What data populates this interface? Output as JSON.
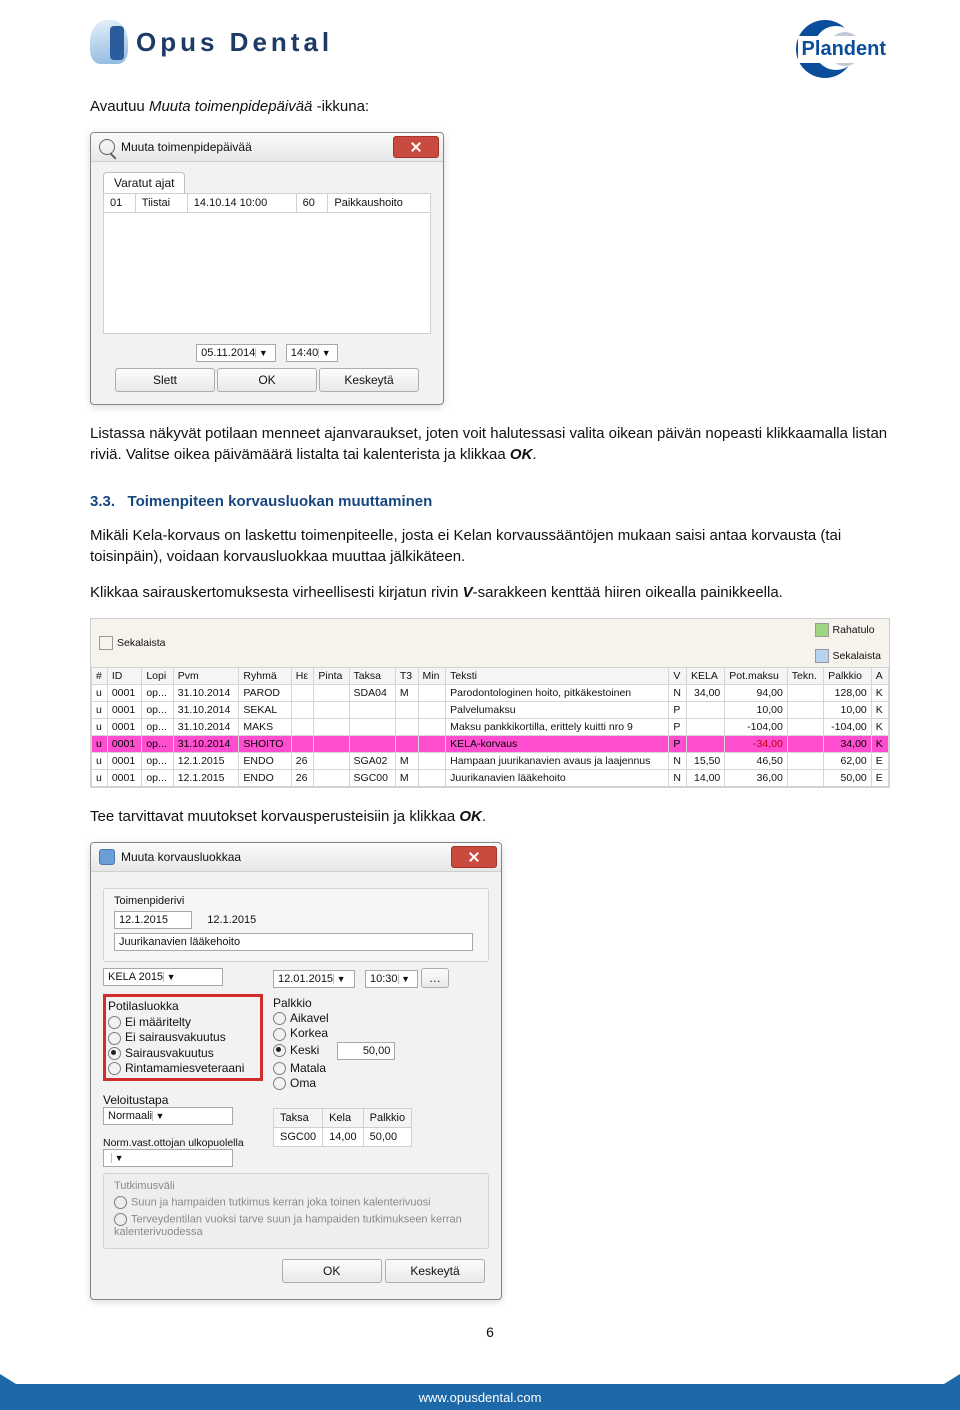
{
  "header": {
    "logo_text": "Opus Dental",
    "plandent": "Plandent"
  },
  "intro": {
    "line1_prefix": "Avautuu ",
    "line1_em": "Muuta toimenpidepäivää",
    "line1_suffix": " -ikkuna:"
  },
  "dialog1": {
    "title": "Muuta toimenpidepäivää",
    "tab": "Varatut ajat",
    "row": {
      "n": "01",
      "day": "Tiistai",
      "date": "14.10.14 10:00",
      "dur": "60",
      "proc": "Paikkaushoito"
    },
    "date_field": "05.11.2014",
    "time_field": "14:40",
    "btn_slett": "Slett",
    "btn_ok": "OK",
    "btn_cancel": "Keskeytä"
  },
  "para1": {
    "a": "Listassa näkyvät potilaan menneet ajanvaraukset, joten voit halutessasi valita oikean päivän nopeasti klikkaamalla listan riviä. Valitse oikea päivämäärä listalta tai kalenterista ja klikkaa ",
    "ok": "OK",
    "b": "."
  },
  "section": {
    "num": "3.3.",
    "title": "Toimenpiteen korvausluokan muuttaminen"
  },
  "para2": "Mikäli Kela-korvaus on laskettu toimenpiteelle, josta ei Kelan korvaussääntöjen mukaan saisi antaa korvausta (tai toisinpäin), voidaan korvausluokkaa muuttaa jälkikäteen.",
  "para3": {
    "a": "Klikkaa sairauskertomuksesta virheellisesti kirjatun rivin ",
    "v": "V",
    "b": "-sarakkeen kenttää hiiren oikealla painikkeella."
  },
  "sk": {
    "tab_left": "Sekalaista",
    "tab_r1": "Rahatulo",
    "tab_r2": "Sekalaista",
    "cols": [
      "#",
      "ID",
      "Lopi",
      "Pvm",
      "Ryhmä",
      "Hε",
      "Pinta",
      "Taksa",
      "T3",
      "Min",
      "Teksti",
      "V",
      "KELA",
      "Pot.maksu",
      "Tekn.",
      "Palkkio",
      "A"
    ],
    "rows": [
      {
        "h": "u",
        "id": "0001",
        "lop": "op...",
        "pvm": "31.10.2014",
        "ryhma": "PAROD",
        "he": "",
        "pinta": "",
        "taksa": "SDA04",
        "t3": "M",
        "min": "",
        "teksti": "Parodontologinen hoito, pitkäkestoinen",
        "v": "N",
        "kela": "34,00",
        "pot": "94,00",
        "tekn": "",
        "palkkio": "128,00",
        "a": "K"
      },
      {
        "h": "u",
        "id": "0001",
        "lop": "op...",
        "pvm": "31.10.2014",
        "ryhma": "SEKAL",
        "he": "",
        "pinta": "",
        "taksa": "",
        "t3": "",
        "min": "",
        "teksti": "Palvelumaksu",
        "v": "P",
        "kela": "",
        "pot": "10,00",
        "tekn": "",
        "palkkio": "10,00",
        "a": "K"
      },
      {
        "h": "u",
        "id": "0001",
        "lop": "op...",
        "pvm": "31.10.2014",
        "ryhma": "MAKS",
        "he": "",
        "pinta": "",
        "taksa": "",
        "t3": "",
        "min": "",
        "teksti": "Maksu pankkikortilla, erittely kuitti nro 9",
        "v": "P",
        "kela": "",
        "pot": "-104,00",
        "tekn": "",
        "palkkio": "-104,00",
        "a": "K"
      },
      {
        "h": "u",
        "id": "0001",
        "lop": "op...",
        "pvm": "31.10.2014",
        "ryhma": "SHOITO",
        "he": "",
        "pinta": "",
        "taksa": "",
        "t3": "",
        "min": "",
        "teksti": "KELA-korvaus",
        "v": "P",
        "kela": "",
        "pot": "-34,00",
        "tekn": "",
        "palkkio": "34,00",
        "a": "K",
        "pink": true
      },
      {
        "h": "u",
        "id": "0001",
        "lop": "op...",
        "pvm": "12.1.2015",
        "ryhma": "ENDO",
        "he": "26",
        "pinta": "",
        "taksa": "SGA02",
        "t3": "M",
        "min": "",
        "teksti": "Hampaan juurikanavien avaus ja laajennus",
        "v": "N",
        "kela": "15,50",
        "pot": "46,50",
        "tekn": "",
        "palkkio": "62,00",
        "a": "E",
        "hl": true
      },
      {
        "h": "u",
        "id": "0001",
        "lop": "op...",
        "pvm": "12.1.2015",
        "ryhma": "ENDO",
        "he": "26",
        "pinta": "",
        "taksa": "SGC00",
        "t3": "M",
        "min": "",
        "teksti": "Juurikanavien lääkehoito",
        "v": "N",
        "kela": "14,00",
        "pot": "36,00",
        "tekn": "",
        "palkkio": "50,00",
        "a": "E"
      }
    ]
  },
  "para4": {
    "a": "Tee tarvittavat muutokset korvausperusteisiin ja klikkaa ",
    "ok": "OK",
    "b": "."
  },
  "dialog2": {
    "title": "Muuta korvausluokkaa",
    "group_top": "Toimenpiderivi",
    "date_a": "12.1.2015",
    "date_b": "12.1.2015",
    "desc": "Juurikanavien lääkehoito",
    "dd_label": "KELA 2015",
    "datefield": "12.01.2015",
    "timefield": "10:30",
    "potilasluokka": "Potilasluokka",
    "pl_opts": [
      "Ei määritelty",
      "Ei sairausvakuutus",
      "Sairausvakuutus",
      "Rintamamiesveteraani"
    ],
    "pl_selected": 2,
    "palkkio": "Palkkio",
    "pk_opts": [
      "Aikavel",
      "Korkea",
      "Keski",
      "Matala",
      "Oma"
    ],
    "pk_selected": 2,
    "pk_value": "50,00",
    "veloitus": "Veloitustapa",
    "veloitus_val": "Normaali",
    "norm": "Norm.vast.ottojan ulkopuolella",
    "t_taksa": "Taksa",
    "t_kela": "Kela",
    "t_palkkio": "Palkkio",
    "row_taksa": "SGC00",
    "row_kela": "14,00",
    "row_palkkio": "50,00",
    "tutkimus": "Tutkimusväli",
    "tut1": "Suun ja hampaiden tutkimus kerran joka toinen kalenterivuosi",
    "tut2": "Terveydentilan vuoksi tarve suun ja hampaiden tutkimukseen kerran kalenterivuodessa",
    "btn_ok": "OK",
    "btn_cancel": "Keskeytä"
  },
  "footer": {
    "page": "6",
    "url": "www.opusdental.com"
  }
}
